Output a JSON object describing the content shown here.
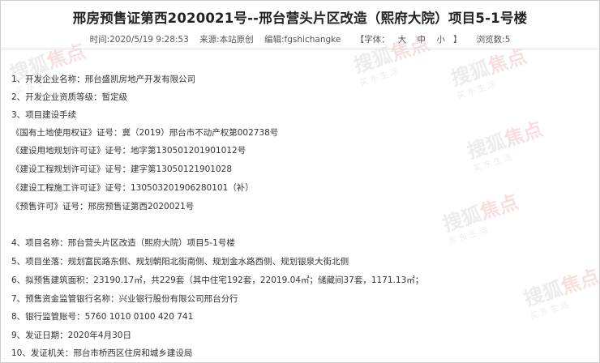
{
  "title": "邢房预售证第西2020021号--邢台营头片区改造（熙府大院）项目5-1号楼",
  "meta": {
    "time": "时间:2020/5/19 9:28:53",
    "source": "来源:本站原创",
    "editor": "编辑:fgshichangke",
    "font_size": {
      "prefix": "【字体：",
      "large": "大",
      "medium": "中",
      "small": "小",
      "suffix": "】"
    },
    "views": "浏览数:5"
  },
  "watermark": {
    "brand_left": "搜狐",
    "brand_right": "焦点",
    "tagline": "买  东  生  活"
  },
  "lines": [
    "1、开发企业名称：邢台盛凯房地产开发有限公司",
    "2、开发企业资质等级：暂定级",
    "3、项目建设手续",
    "《国有土地使用权证》证号：冀（2019）邢台市不动产权第002738号",
    "《建设用地规划许可证》证号：地字第130501201901012号",
    "《建设工程规划许可证》证号：建字第13050121901028",
    "《建设工程施工许可证》证号：130503201906280101（补）",
    "《预售许可》证号：邢房预售证第西2020021号",
    "4、项目名称：邢台营头片区改造（熙府大院）项目5-1号楼",
    "5、项目坐落：规划富民路东侧、规划朝阳北街南侧、规划金水路西侧、规划银泉大街北侧",
    "6、拟预售建筑面积：23190.17㎡，共229套（其中住宅192套，22019.04㎡；储藏间37套，1171.13㎡；",
    "7、预售资金监管银行名称：兴业银行股份有限公司邢台分行",
    "8、银行监管账号：5760 1010 0100 420 741",
    "9、发证日期：2020年4月30日",
    "10、发证机关：邢台市桥西区住房和城乡建设局"
  ]
}
